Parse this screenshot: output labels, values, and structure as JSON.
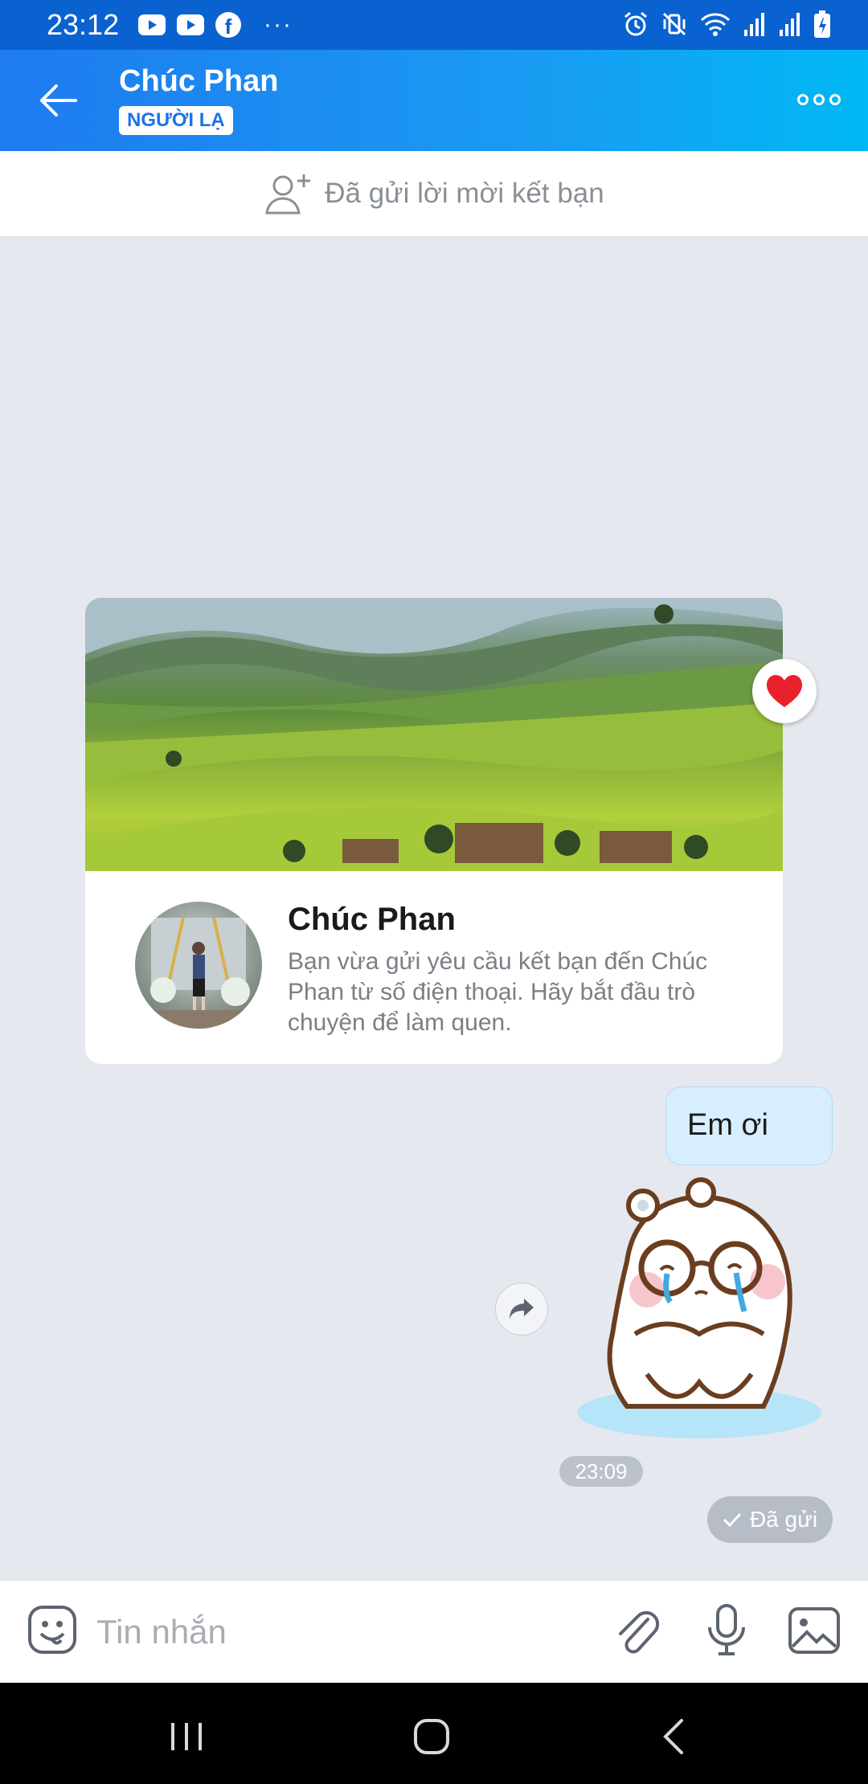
{
  "status_bar": {
    "time": "23:12",
    "left_icons": [
      "youtube-icon",
      "youtube-icon",
      "facebook-icon",
      "more-notifications-icon"
    ],
    "overflow_glyph": "···",
    "right_icons": [
      "alarm-icon",
      "vibrate-mute-icon",
      "wifi-icon",
      "signal-icon",
      "signal-icon",
      "battery-charging-icon"
    ]
  },
  "header": {
    "name": "Chúc Phan",
    "badge": "NGƯỜI LẠ"
  },
  "friend_bar": {
    "text": "Đã gửi lời mời kết bạn"
  },
  "profile_card": {
    "name": "Chúc Phan",
    "description": "Bạn vừa gửi yêu cầu kết bạn đến Chúc Phan từ số điện thoại. Hãy bắt đầu trò chuyện để làm quen."
  },
  "messages": {
    "text": "Em ơi",
    "time": "23:09",
    "status": "Đã gửi"
  },
  "input": {
    "placeholder": "Tin nhắn"
  },
  "colors": {
    "header_start": "#1e7bf0",
    "header_end": "#00b8f5",
    "chat_bg": "#e5e9ef",
    "bubble_bg": "#d7eefe"
  }
}
